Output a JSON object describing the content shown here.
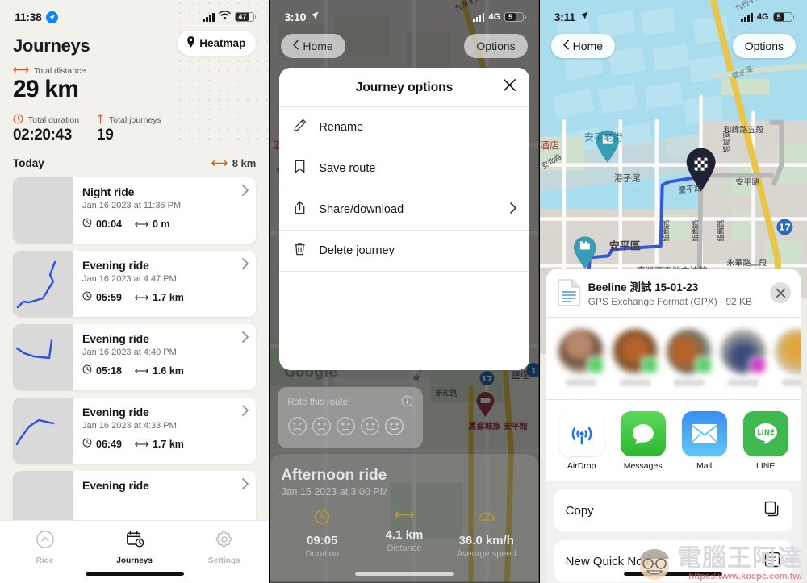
{
  "panels": {
    "journeys": {
      "status": {
        "time": "11:38",
        "location_icon": "location-arrow-icon",
        "network": "wifi",
        "battery": "47"
      },
      "title": "Journeys",
      "heatmap_button": "Heatmap",
      "stats": {
        "distance_label": "Total distance",
        "distance_value": "29 km",
        "duration_label": "Total duration",
        "duration_value": "02:20:43",
        "journeys_label": "Total journeys",
        "journeys_value": "19"
      },
      "section": {
        "label": "Today",
        "distance": "8 km"
      },
      "items": [
        {
          "name": "Night ride",
          "date": "Jan 16 2023 at 11:36 PM",
          "duration": "00:04",
          "distance": "0 m",
          "track": "none"
        },
        {
          "name": "Evening ride",
          "date": "Jan 16 2023 at 4:47 PM",
          "duration": "05:59",
          "distance": "1.7 km",
          "track": "a"
        },
        {
          "name": "Evening ride",
          "date": "Jan 16 2023 at 4:40 PM",
          "duration": "05:18",
          "distance": "1.6 km",
          "track": "b"
        },
        {
          "name": "Evening ride",
          "date": "Jan 16 2023 at 4:33 PM",
          "duration": "06:49",
          "distance": "1.7 km",
          "track": "c"
        },
        {
          "name": "Evening ride",
          "date": "",
          "duration": "",
          "distance": "",
          "track": "d"
        }
      ],
      "tabs": [
        {
          "label": "Ride",
          "icon": "chevron-up-circle-icon",
          "active": false
        },
        {
          "label": "Journeys",
          "icon": "calendar-clock-icon",
          "active": true
        },
        {
          "label": "Settings",
          "icon": "gear-icon",
          "active": false
        }
      ]
    },
    "options": {
      "status": {
        "time": "3:10",
        "location_icon": "location-arrow-icon",
        "network": "4G",
        "battery": "5"
      },
      "nav": {
        "back": "Home",
        "options": "Options"
      },
      "dialog": {
        "title": "Journey options",
        "close_icon": "close-icon",
        "items": [
          {
            "label": "Rename",
            "icon": "pencil-icon",
            "chevron": false
          },
          {
            "label": "Save route",
            "icon": "bookmark-icon",
            "chevron": false
          },
          {
            "label": "Share/download",
            "icon": "share-icon",
            "chevron": true
          },
          {
            "label": "Delete journey",
            "icon": "trash-icon",
            "chevron": false
          }
        ]
      },
      "rate": {
        "label": "Rate this route:",
        "info_icon": "info-icon"
      },
      "summary": {
        "title": "Afternoon ride",
        "date": "Jan 15 2023 at 3:00 PM",
        "stats": [
          {
            "value": "09:05",
            "label": "Duration",
            "icon": "clock-icon"
          },
          {
            "value": "4.1 km",
            "label": "Distance",
            "icon": "distance-icon"
          },
          {
            "value": "36.0 km/h",
            "label": "Average speed",
            "icon": "speedometer-icon"
          }
        ]
      },
      "map_labels": [
        "九份子大道",
        "酒店",
        "新和路",
        "新..路",
        "鹽埕",
        "17",
        "夏都城旅 安平館"
      ]
    },
    "share": {
      "status": {
        "time": "3:11",
        "location_icon": "location-arrow-icon",
        "network": "4G",
        "battery": "5"
      },
      "nav": {
        "back": "Home",
        "options": "Options"
      },
      "map_labels": [
        "九份子大道",
        "鹽水溪",
        "和緯路五段",
        "安平老街",
        "酒店",
        "安北路",
        "港子尾",
        "安平區",
        "慶平路",
        "安平路",
        "永華路二段",
        "臺灣臺南地方法院",
        "17"
      ],
      "file": {
        "name": "Beeline 測試 15-01-23",
        "meta": "GPS Exchange Format (GPX) · 92 KB",
        "close_icon": "close-icon",
        "icon": "document-icon"
      },
      "apps": [
        {
          "label": "AirDrop",
          "icon": "airdrop-icon"
        },
        {
          "label": "Messages",
          "icon": "messages-icon"
        },
        {
          "label": "Mail",
          "icon": "mail-icon"
        },
        {
          "label": "LINE",
          "icon": "line-icon"
        }
      ],
      "actions": [
        {
          "label": "Copy",
          "icon": "copy-icon"
        },
        {
          "label": "New Quick Note",
          "icon": "quick-note-icon"
        }
      ]
    }
  },
  "watermark": {
    "text": "電腦王阿達",
    "url": "https://www.kocpc.com.tw/"
  },
  "colors": {
    "accent_orange": "#e2551f",
    "track_blue": "#2f4fe0",
    "paper": "#f2f1ec",
    "card": "#ffffff",
    "ios_blue": "#0a84ff",
    "green": "#4cd964"
  }
}
